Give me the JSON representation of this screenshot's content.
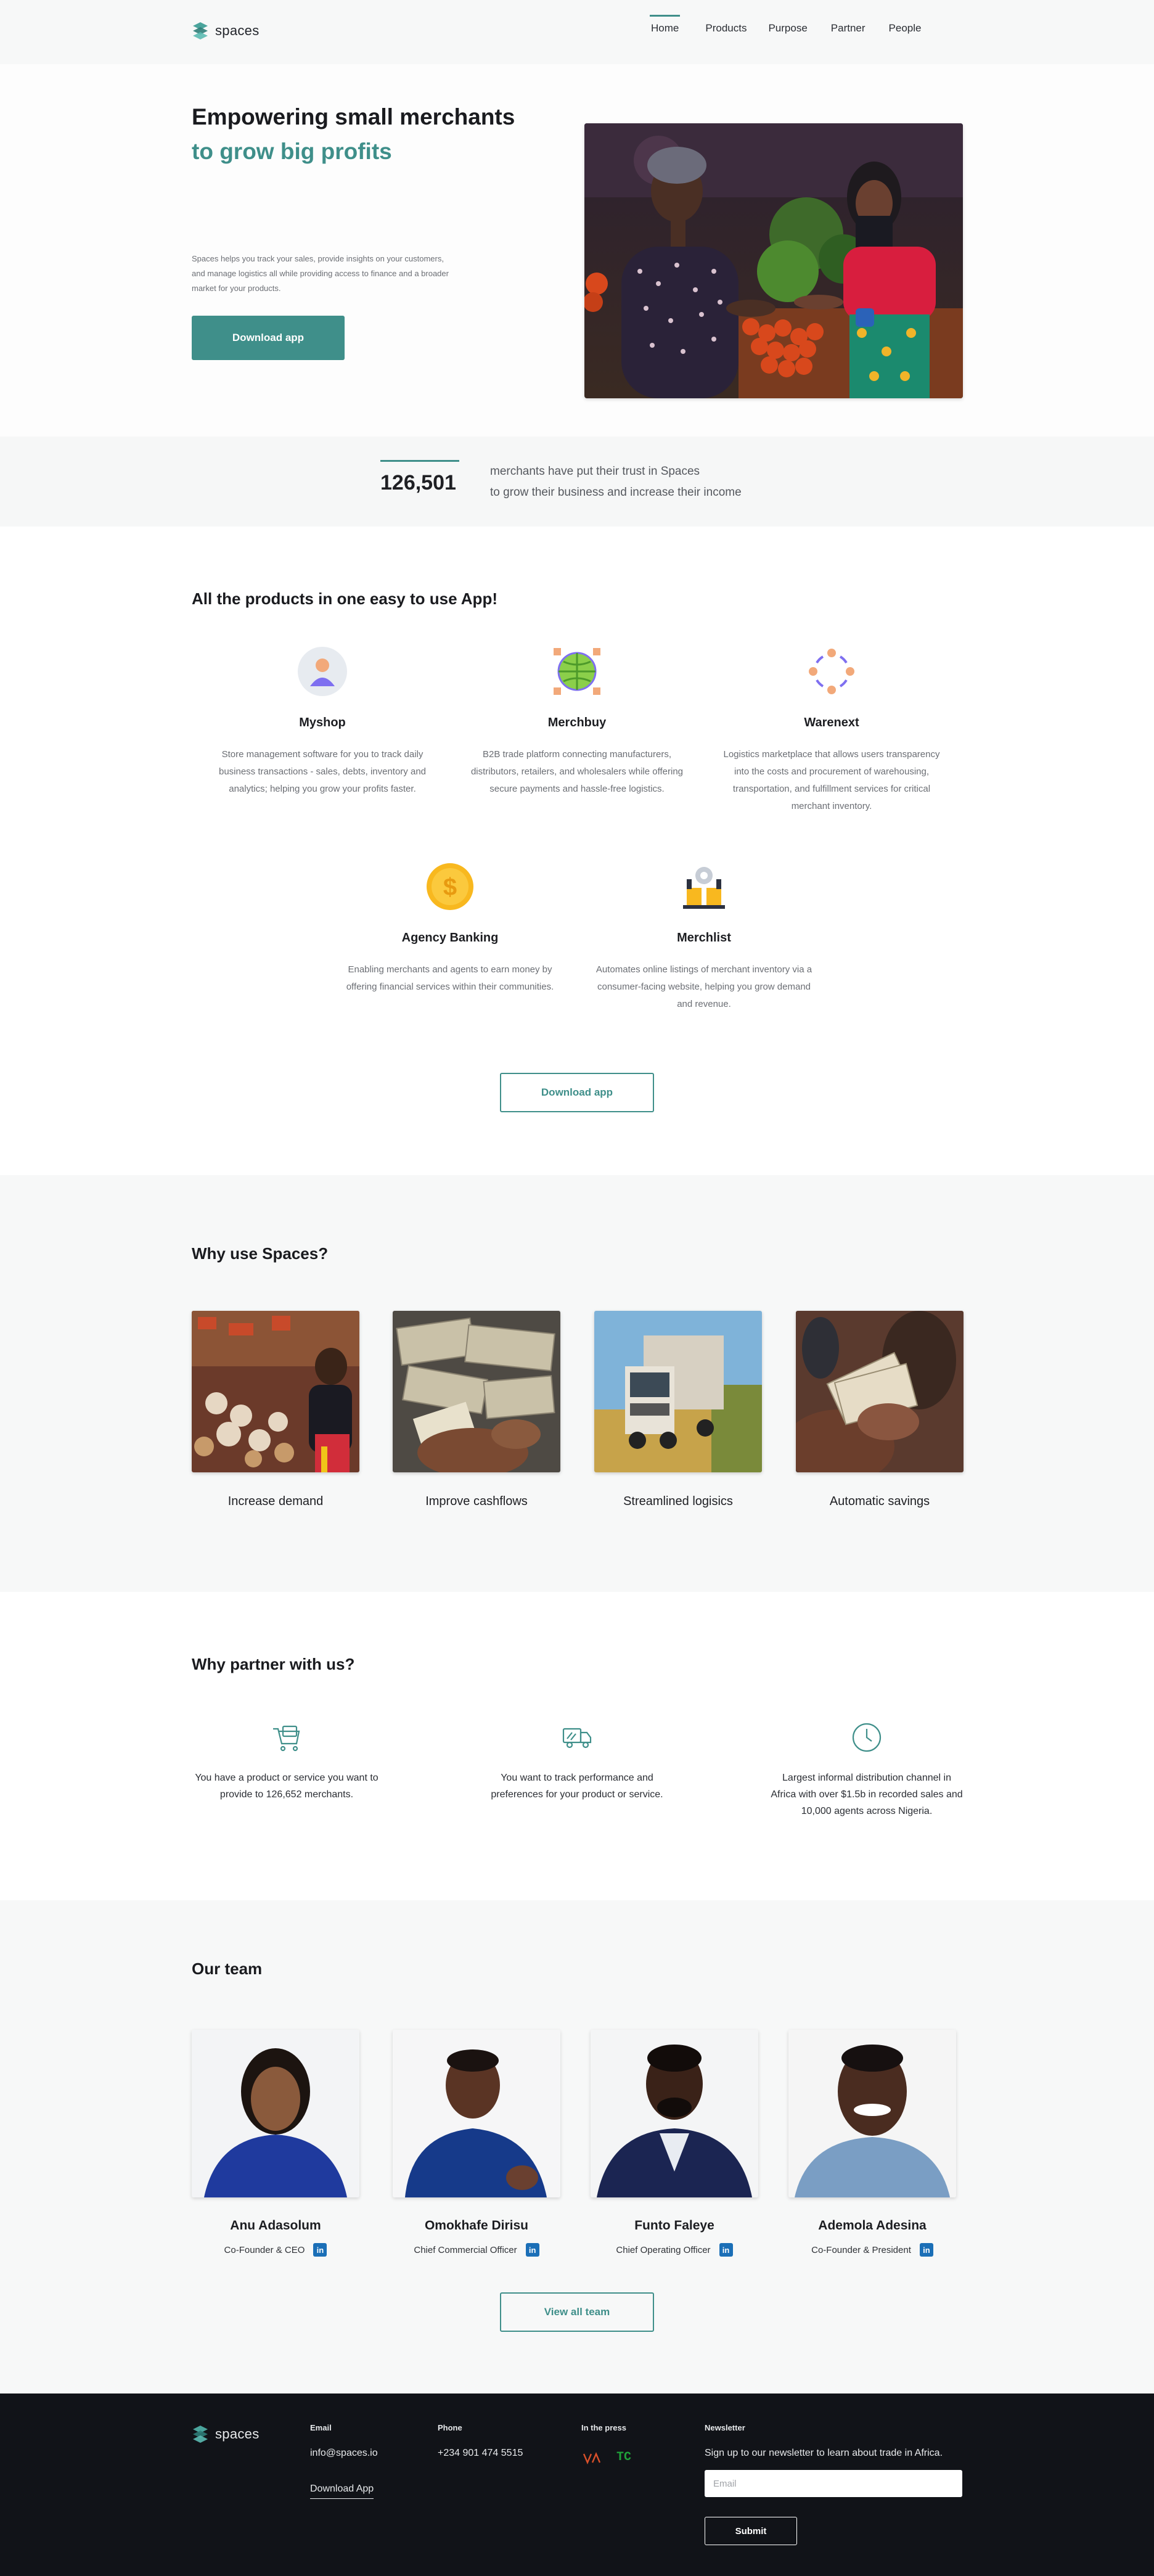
{
  "brand": {
    "name": "spaces",
    "accent": "#3f8f8a"
  },
  "nav": {
    "items": [
      {
        "label": "Home",
        "active": true
      },
      {
        "label": "Products",
        "active": false
      },
      {
        "label": "Purpose",
        "active": false
      },
      {
        "label": "Partner",
        "active": false
      },
      {
        "label": "People",
        "active": false
      }
    ]
  },
  "hero": {
    "title_line1": "Empowering small merchants",
    "title_line2": "to grow big profits",
    "description": "Spaces helps you track your sales, provide insights on your customers, and manage logistics all while providing access to finance and a broader market for your products.",
    "cta": "Download app"
  },
  "stats": {
    "number": "126,501",
    "line1": "merchants have put their trust in Spaces",
    "line2": "to grow their business and increase their income"
  },
  "products": {
    "heading": "All the products in one easy to use App!",
    "items": [
      {
        "name": "Myshop",
        "icon": "person-icon",
        "desc": "Store management software for you to track daily business transactions - sales, debts, inventory and analytics; helping you grow your profits faster."
      },
      {
        "name": "Merchbuy",
        "icon": "globe-icon",
        "desc": "B2B trade platform connecting manufacturers, distributors, retailers, and wholesalers while offering secure payments and hassle-free logistics."
      },
      {
        "name": "Warenext",
        "icon": "network-icon",
        "desc": "Logistics marketplace that allows users transparency into the costs and procurement of warehousing, transportation, and fulfillment services for critical merchant inventory."
      },
      {
        "name": "Agency Banking",
        "icon": "dollar-coin-icon",
        "desc": "Enabling merchants and agents to earn money by offering financial services within their communities."
      },
      {
        "name": "Merchlist",
        "icon": "shop-gear-icon",
        "desc": "Automates online listings of merchant inventory via a consumer-facing website, helping you grow demand and revenue."
      }
    ],
    "cta": "Download app"
  },
  "why_use": {
    "heading": "Why use Spaces?",
    "items": [
      {
        "label": "Increase demand"
      },
      {
        "label": "Improve cashflows"
      },
      {
        "label": "Streamlined logisics"
      },
      {
        "label": "Automatic savings"
      }
    ]
  },
  "partner": {
    "heading": "Why partner with us?",
    "items": [
      {
        "icon": "cart-icon",
        "text": "You have a product or service you want to provide to 126,652 merchants."
      },
      {
        "icon": "delivery-truck-icon",
        "text": "You want to track performance and preferences for your product or service."
      },
      {
        "icon": "clock-icon",
        "text": "Largest informal distribution channel in Africa with over $1.5b in recorded sales and 10,000 agents across Nigeria."
      }
    ]
  },
  "team": {
    "heading": "Our team",
    "members": [
      {
        "name": "Anu Adasolum",
        "role": "Co-Founder & CEO"
      },
      {
        "name": "Omokhafe Dirisu",
        "role": "Chief Commercial Officer"
      },
      {
        "name": "Funto Faleye",
        "role": "Chief Operating Officer"
      },
      {
        "name": "Ademola Adesina",
        "role": "Co-Founder & President"
      }
    ],
    "linkedin_glyph": "in",
    "cta": "View all team"
  },
  "footer": {
    "brand": "spaces",
    "email_heading": "Email",
    "email": "info@spaces.io",
    "download_link": "Download App",
    "phone_heading": "Phone",
    "phone": "+234 901 474 5515",
    "press_heading": "In the press",
    "press_logo_2": "TC",
    "newsletter_heading": "Newsletter",
    "newsletter_text": "Sign up to our newsletter to learn about trade in Africa.",
    "email_placeholder": "Email",
    "submit": "Submit"
  }
}
